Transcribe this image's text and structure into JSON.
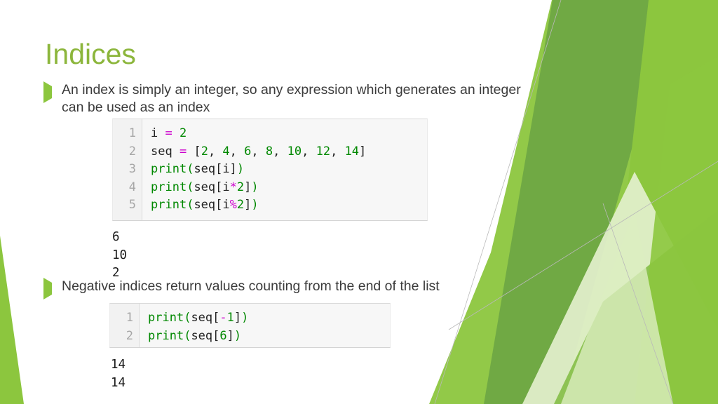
{
  "slide": {
    "title": "Indices",
    "theme": {
      "title_color": "#8CB63C",
      "bullet_marker_color": "#8CC63E",
      "body_text_color": "#3b3b3b",
      "background": "#ffffff",
      "code_background": "#f7f7f7",
      "code_gutter_background": "#f2f2f2",
      "code_linenumber_color": "#a6a6a6",
      "syntax_operator_color": "#cc00cc",
      "syntax_number_color": "#008800",
      "syntax_builtin_color": "#008800",
      "syntax_identifier_color": "#222222",
      "decor_green_dark": "#6fa844",
      "decor_green_mid": "#7fbb3f",
      "decor_green_bright": "#8cc63e",
      "decor_green_light": "#c2e08c",
      "decor_green_pale": "#e3f0cd"
    }
  },
  "bullets": [
    {
      "marker": "triangle-right-icon",
      "text": "An index is simply an integer, so any expression which generates an integer can be used as an index"
    },
    {
      "marker": "triangle-right-icon",
      "text": "Negative indices return values counting from the end of the list"
    }
  ],
  "code_blocks": [
    {
      "id": "code-block-1",
      "line_numbers": [
        "1",
        "2",
        "3",
        "4",
        "5"
      ],
      "lines": [
        "i = 2",
        "seq = [2, 4, 6, 8, 10, 12, 14]",
        "print(seq[i])",
        "print(seq[i*2])",
        "print(seq[i%2])"
      ],
      "tokens": [
        [
          {
            "t": "i ",
            "c": "name"
          },
          {
            "t": "=",
            "c": "op"
          },
          {
            "t": " ",
            "c": "name"
          },
          {
            "t": "2",
            "c": "num"
          }
        ],
        [
          {
            "t": "seq ",
            "c": "name"
          },
          {
            "t": "=",
            "c": "op"
          },
          {
            "t": " [",
            "c": "name"
          },
          {
            "t": "2",
            "c": "num"
          },
          {
            "t": ", ",
            "c": "name"
          },
          {
            "t": "4",
            "c": "num"
          },
          {
            "t": ", ",
            "c": "name"
          },
          {
            "t": "6",
            "c": "num"
          },
          {
            "t": ", ",
            "c": "name"
          },
          {
            "t": "8",
            "c": "num"
          },
          {
            "t": ", ",
            "c": "name"
          },
          {
            "t": "10",
            "c": "num"
          },
          {
            "t": ", ",
            "c": "name"
          },
          {
            "t": "12",
            "c": "num"
          },
          {
            "t": ", ",
            "c": "name"
          },
          {
            "t": "14",
            "c": "num"
          },
          {
            "t": "]",
            "c": "name"
          }
        ],
        [
          {
            "t": "print",
            "c": "fn"
          },
          {
            "t": "(",
            "c": "punc"
          },
          {
            "t": "seq[i]",
            "c": "name"
          },
          {
            "t": ")",
            "c": "punc"
          }
        ],
        [
          {
            "t": "print",
            "c": "fn"
          },
          {
            "t": "(",
            "c": "punc"
          },
          {
            "t": "seq[i",
            "c": "name"
          },
          {
            "t": "*",
            "c": "op"
          },
          {
            "t": "2",
            "c": "num"
          },
          {
            "t": "]",
            "c": "name"
          },
          {
            "t": ")",
            "c": "punc"
          }
        ],
        [
          {
            "t": "print",
            "c": "fn"
          },
          {
            "t": "(",
            "c": "punc"
          },
          {
            "t": "seq[i",
            "c": "name"
          },
          {
            "t": "%",
            "c": "op"
          },
          {
            "t": "2",
            "c": "num"
          },
          {
            "t": "]",
            "c": "name"
          },
          {
            "t": ")",
            "c": "punc"
          }
        ]
      ]
    },
    {
      "id": "code-block-2",
      "line_numbers": [
        "1",
        "2"
      ],
      "lines": [
        "print(seq[-1])",
        "print(seq[6])"
      ],
      "tokens": [
        [
          {
            "t": "print",
            "c": "fn"
          },
          {
            "t": "(",
            "c": "punc"
          },
          {
            "t": "seq[",
            "c": "name"
          },
          {
            "t": "-",
            "c": "op"
          },
          {
            "t": "1",
            "c": "num"
          },
          {
            "t": "]",
            "c": "name"
          },
          {
            "t": ")",
            "c": "punc"
          }
        ],
        [
          {
            "t": "print",
            "c": "fn"
          },
          {
            "t": "(",
            "c": "punc"
          },
          {
            "t": "seq[",
            "c": "name"
          },
          {
            "t": "6",
            "c": "num"
          },
          {
            "t": "]",
            "c": "name"
          },
          {
            "t": ")",
            "c": "punc"
          }
        ]
      ]
    }
  ],
  "outputs": [
    {
      "id": "output-1",
      "lines": [
        "6",
        "10",
        "2"
      ]
    },
    {
      "id": "output-2",
      "lines": [
        "14",
        "14"
      ]
    }
  ]
}
